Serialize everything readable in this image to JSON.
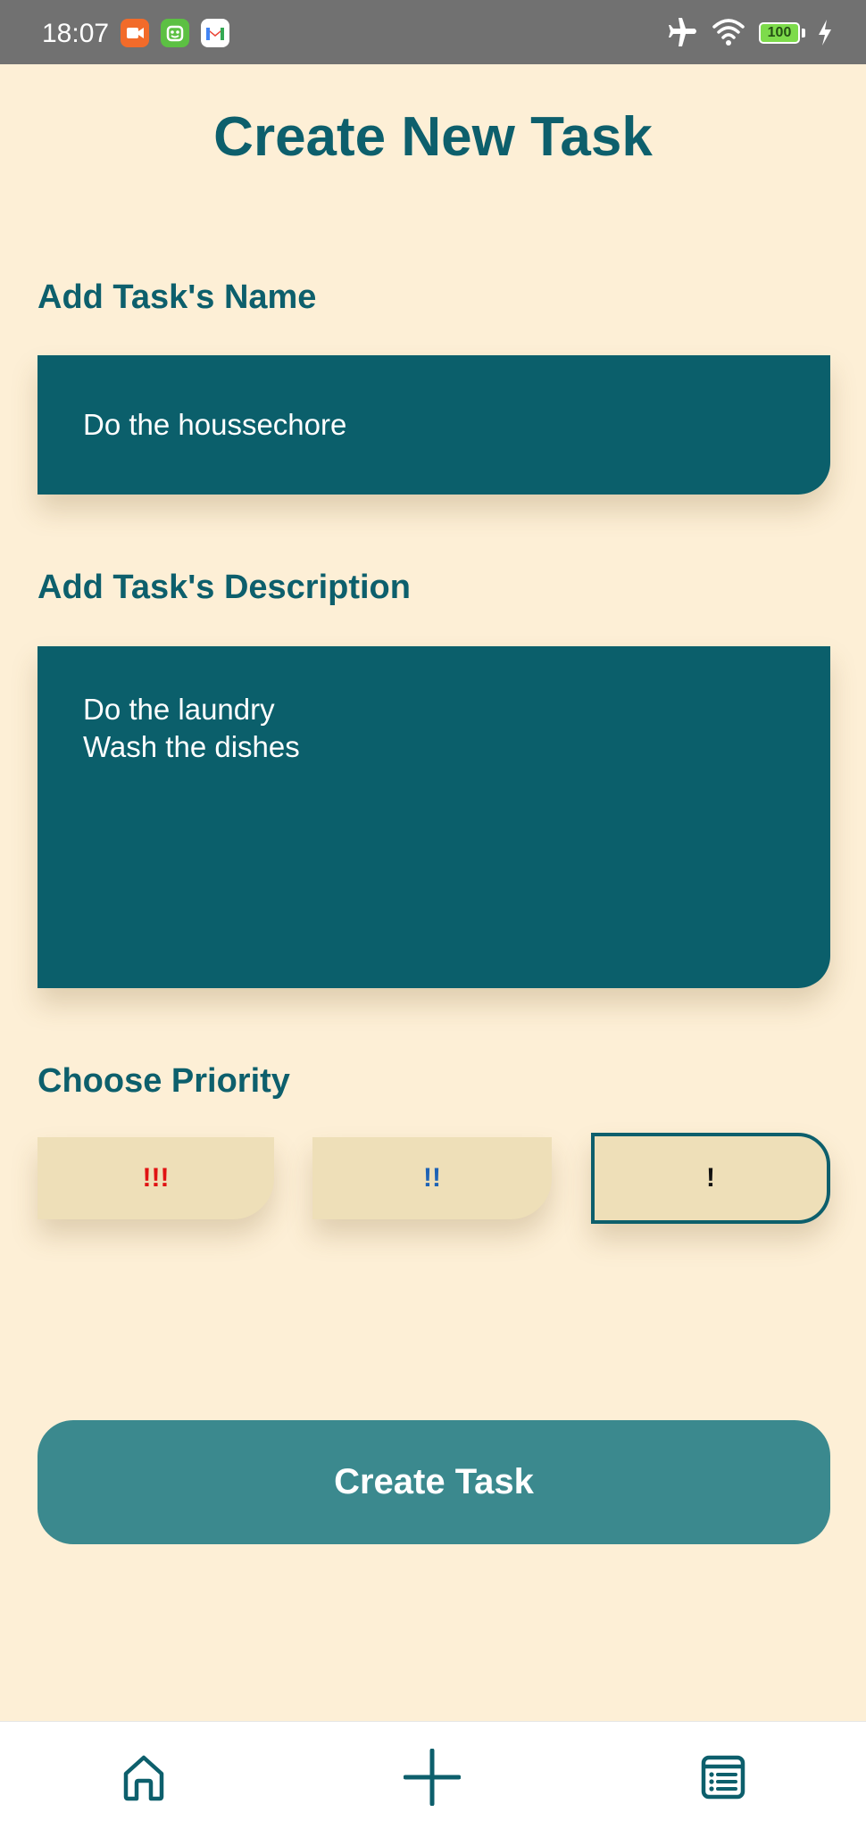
{
  "status_bar": {
    "time": "18:07",
    "battery": "100",
    "icons": [
      "meet-icon",
      "bot-icon",
      "gmail-icon",
      "airplane-icon",
      "wifi-icon",
      "battery-icon",
      "charging-icon"
    ]
  },
  "page": {
    "title": "Create New Task"
  },
  "task_name": {
    "label": "Add Task's Name",
    "value": "Do the houssechore"
  },
  "task_description": {
    "label": "Add Task's Description",
    "value": "Do the laundry\nWash the dishes"
  },
  "priority": {
    "label": "Choose Priority",
    "options": [
      {
        "label": "!!!",
        "level": "high",
        "color": "#E01212"
      },
      {
        "label": "!!",
        "level": "medium",
        "color": "#1E63B5"
      },
      {
        "label": "!",
        "level": "low",
        "color": "#111111",
        "selected": true
      }
    ]
  },
  "actions": {
    "create_label": "Create Task"
  },
  "bottom_nav": {
    "items": [
      {
        "icon": "home-icon"
      },
      {
        "icon": "add-icon",
        "active": true
      },
      {
        "icon": "task-list-icon"
      }
    ]
  },
  "colors": {
    "background": "#FDEFD6",
    "primary": "#0D5F6C",
    "button": "#3B898E",
    "priority_bg": "#EEDFB8"
  }
}
